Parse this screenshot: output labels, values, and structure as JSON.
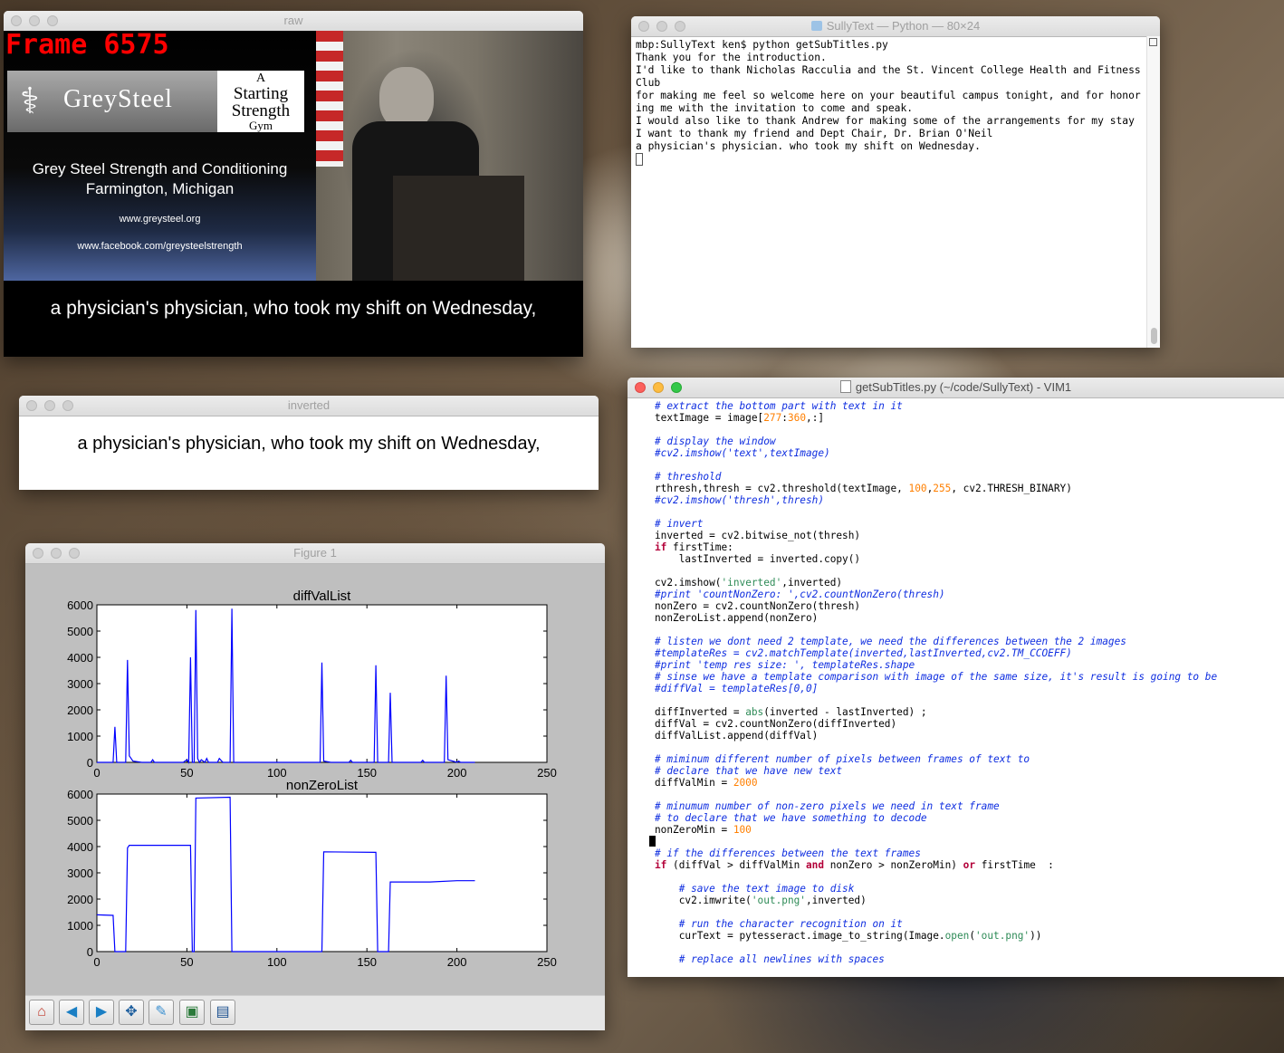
{
  "raw_window": {
    "title": "raw",
    "frame_label": "Frame 6575",
    "logo_text": "GreySteel",
    "gym_lines": [
      "A",
      "Starting",
      "Strength",
      "Gym"
    ],
    "slide_line1": "Grey Steel Strength and Conditioning",
    "slide_line2": "Farmington, Michigan",
    "slide_url1": "www.greysteel.org",
    "slide_url2": "www.facebook.com/greysteelstrength",
    "subtitle": "a physician's physician, who took my shift on Wednesday,"
  },
  "inverted_window": {
    "title": "inverted",
    "text": "a physician's physician, who took my shift on Wednesday,"
  },
  "terminal_window": {
    "title": "SullyText — Python — 80×24",
    "content": "mbp:SullyText ken$ python getSubTitles.py\nThank you for the introduction.\nI'd like to thank Nicholas Racculia and the St. Vincent College Health and Fitness Club\nfor making me feel so welcome here on your beautiful campus tonight, and for honoring me with the invitation to come and speak.\nI would also like to thank Andrew for making some of the arrangements for my stay\nI want to thank my friend and Dept Chair, Dr. Brian O'Neil\na physician's physician. who took my shift on Wednesday."
  },
  "vim_window": {
    "title": "getSubTitles.py (~/code/SullyText) - VIM1"
  },
  "figure_window": {
    "title": "Figure 1",
    "toolbar": [
      "home-icon",
      "back-icon",
      "forward-icon",
      "pan-icon",
      "configure-icon",
      "zoom-icon",
      "save-icon"
    ]
  },
  "chart_data": [
    {
      "type": "line",
      "title": "diffValList",
      "xlabel": "",
      "ylabel": "",
      "xlim": [
        0,
        250
      ],
      "ylim": [
        0,
        6000
      ],
      "xticks": [
        0,
        50,
        100,
        150,
        200,
        250
      ],
      "yticks": [
        0,
        1000,
        2000,
        3000,
        4000,
        5000,
        6000
      ],
      "color": "#0000ff",
      "x": [
        0,
        9,
        10,
        11,
        16,
        17,
        18,
        20,
        25,
        30,
        31,
        32,
        40,
        45,
        48,
        50,
        51,
        52,
        53,
        54,
        55,
        56,
        57,
        58,
        60,
        61,
        62,
        65,
        67,
        68,
        70,
        74,
        75,
        76,
        80,
        100,
        120,
        124,
        125,
        126,
        130,
        140,
        141,
        142,
        150,
        154,
        155,
        156,
        160,
        162,
        163,
        164,
        170,
        180,
        181,
        182,
        190,
        193,
        194,
        195,
        200,
        201,
        202,
        210
      ],
      "y": [
        0,
        0,
        1350,
        0,
        0,
        3900,
        250,
        50,
        0,
        0,
        100,
        0,
        0,
        0,
        0,
        100,
        0,
        4000,
        0,
        0,
        5800,
        150,
        0,
        100,
        0,
        150,
        0,
        0,
        0,
        150,
        0,
        0,
        5850,
        0,
        0,
        0,
        0,
        0,
        3800,
        50,
        0,
        0,
        80,
        0,
        0,
        0,
        3700,
        0,
        0,
        0,
        2650,
        0,
        0,
        0,
        80,
        0,
        0,
        0,
        3300,
        100,
        0,
        50,
        0,
        0
      ]
    },
    {
      "type": "line",
      "title": "nonZeroList",
      "xlabel": "",
      "ylabel": "",
      "xlim": [
        0,
        250
      ],
      "ylim": [
        0,
        6000
      ],
      "xticks": [
        0,
        50,
        100,
        150,
        200,
        250
      ],
      "yticks": [
        0,
        1000,
        2000,
        3000,
        4000,
        5000,
        6000
      ],
      "color": "#0000ff",
      "x": [
        0,
        9,
        10,
        16,
        17,
        18,
        52,
        53,
        54,
        55,
        74,
        75,
        125,
        126,
        155,
        156,
        162,
        163,
        185,
        200,
        210
      ],
      "y": [
        1400,
        1380,
        0,
        0,
        3950,
        4050,
        4050,
        0,
        0,
        5850,
        5880,
        0,
        0,
        3800,
        3780,
        0,
        0,
        2650,
        2650,
        2700,
        2700
      ]
    }
  ]
}
